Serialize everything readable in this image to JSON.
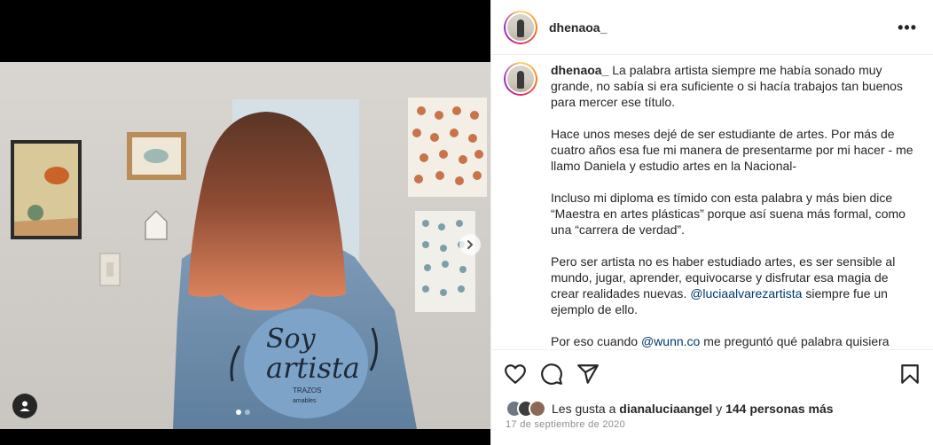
{
  "post": {
    "username": "dhenaoa_",
    "more_label": "•••",
    "caption": {
      "handle": "dhenaoa_",
      "p1": "La palabra artista siempre me había sonado muy grande, no sabía si era suficiente o si hacía trabajos tan buenos para mercer ese título.",
      "p2": "Hace unos meses dejé de ser estudiante de artes. Por más de cuatro años esa fue mi manera de presentarme por mi hacer - me llamo Daniela y estudio artes en la Nacional-",
      "p3": "Incluso mi diploma es tímido con esta palabra y más bien dice “Maestra en artes plásticas” porque así suena más formal, como una “carrera de verdad”.",
      "p4_start": "Pero ser artista no es haber estudiado artes, es ser sensible al mundo, jugar, aprender, equivocarse y disfrutar esa magia de crear realidades nuevas.",
      "p4_mention": "@luciaalvarezartista",
      "p4_end": "siempre fue un ejemplo de ello.",
      "p5_start": "Por eso cuando",
      "p5_mention": "@wunn.co",
      "p5_end": "me preguntó qué palabra quisiera"
    },
    "likes": {
      "prefix": "Les gusta a",
      "user": "dianaluciaangel",
      "connector": "y",
      "others": "144 personas más"
    },
    "date": "17 de septiembre de 2020",
    "jacket_text": {
      "line1": "Soy",
      "line2": "artista",
      "line3": "TRAZOS",
      "line4": "amables"
    }
  },
  "carousel": {
    "count": 2,
    "active_index": 0
  },
  "colors": {
    "mention": "#00376b",
    "muted": "#8e8e8e",
    "text": "#262626"
  },
  "icons": [
    "user-tag-icon",
    "chevron-right-icon",
    "heart-icon",
    "comment-icon",
    "share-icon",
    "bookmark-icon",
    "more-icon"
  ]
}
